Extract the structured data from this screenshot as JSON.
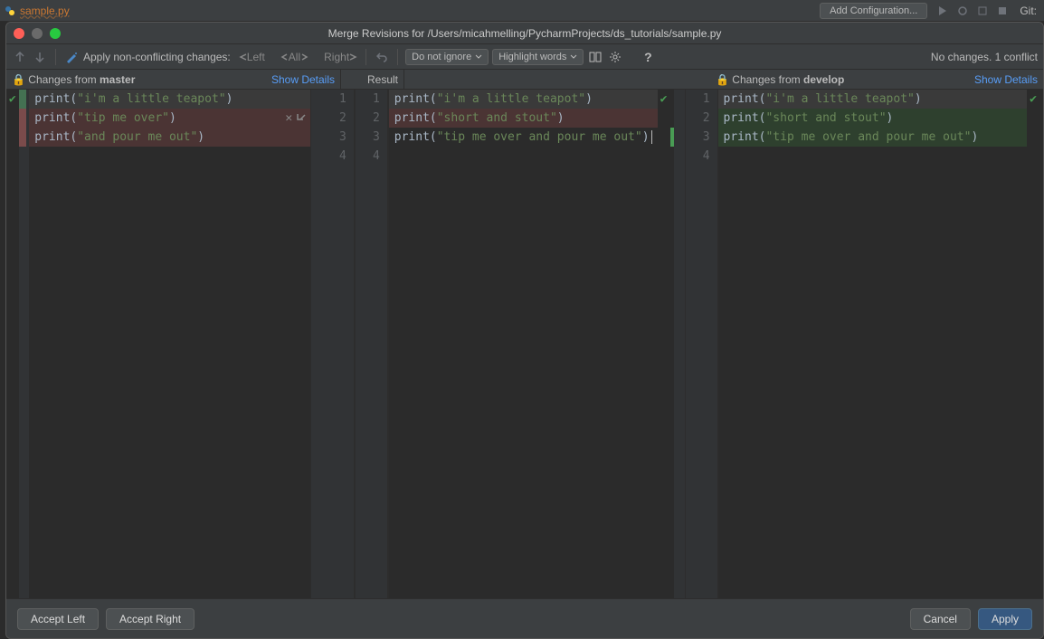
{
  "topbar": {
    "filename": "sample.py",
    "add_config": "Add Configuration...",
    "git_label": "Git:"
  },
  "dialog": {
    "title": "Merge Revisions for /Users/micahmelling/PycharmProjects/ds_tutorials/sample.py"
  },
  "toolbar": {
    "apply_label": "Apply non-conflicting changes:",
    "left": "Left",
    "all": "All",
    "right": "Right",
    "ignore_combo": "Do not ignore",
    "highlight_combo": "Highlight words",
    "status": "No changes. 1 conflict"
  },
  "headers": {
    "left_prefix": "Changes from ",
    "left_branch": "master",
    "result": "Result",
    "right_prefix": "Changes from ",
    "right_branch": "develop",
    "show_details": "Show Details"
  },
  "code": {
    "left": [
      {
        "fn": "print",
        "str": "\"i'm a little teapot\"",
        "bg": "grey",
        "marker": "green",
        "check": true
      },
      {
        "fn": "print",
        "str": "\"tip me over\"",
        "bg": "red",
        "marker": "red",
        "actions": true
      },
      {
        "fn": "print",
        "str": "\"and pour me out\"",
        "bg": "red",
        "marker": "red"
      }
    ],
    "left_gutter": [
      "1",
      "2",
      "3",
      "4"
    ],
    "center_gutter": [
      "1",
      "2",
      "3",
      "4"
    ],
    "center": [
      {
        "fn": "print",
        "str": "\"i'm a little teapot\"",
        "bg": "grey",
        "rcheck": true
      },
      {
        "fn": "print",
        "str": "\"short and stout\"",
        "bg": "red"
      },
      {
        "fn": "print",
        "str": "\"tip me over and pour me out\"",
        "rmarker": "green",
        "caret": true
      }
    ],
    "right_gutter": [
      "1",
      "2",
      "3",
      "4"
    ],
    "right": [
      {
        "fn": "print",
        "str": "\"i'm a little teapot\"",
        "bg": "grey",
        "rcheck": true
      },
      {
        "fn": "print",
        "str": "\"short and stout\"",
        "bg": "green"
      },
      {
        "fn": "print",
        "str": "\"tip me over and pour me out\"",
        "bg": "green"
      }
    ]
  },
  "buttons": {
    "accept_left": "Accept Left",
    "accept_right": "Accept Right",
    "cancel": "Cancel",
    "apply": "Apply"
  }
}
